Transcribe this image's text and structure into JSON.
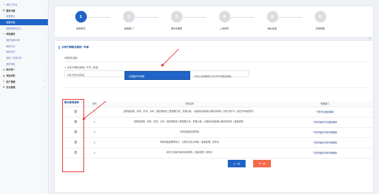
{
  "sidebar": {
    "home": "我的工作台",
    "groups": [
      {
        "label": "服务申报",
        "icon": "grid-icon",
        "items": [
          "我要登记",
          "我要申报",
          "我要审核任务工"
        ]
      },
      {
        "label": "审批服务",
        "icon": "briefcase-icon",
        "items": [
          "我的待审清单",
          "我的已办",
          "我的办件",
          "我的一件事办件",
          "我的消息"
        ]
      },
      {
        "label": "统计统一",
        "icon": "chart-icon",
        "items": []
      },
      {
        "label": "审批材料",
        "icon": "folder-icon",
        "items": []
      },
      {
        "label": "用户管理",
        "icon": "user-icon",
        "items": []
      },
      {
        "label": "安全管理",
        "icon": "shield-icon",
        "items": []
      }
    ]
  },
  "steps": [
    {
      "num": "1",
      "label": "选择事项"
    },
    {
      "num": "2",
      "label": "选择部门"
    },
    {
      "num": "3",
      "label": "填写申报表"
    },
    {
      "num": "4",
      "label": "上传材料"
    },
    {
      "num": "5",
      "label": "确认信息"
    },
    {
      "num": "6",
      "label": "完成申报"
    }
  ],
  "section": {
    "title": "水电气网联合报装一件事",
    "sub_label": "办理情形选择",
    "question": "1. 水电气网联合报装一件事（单选）",
    "option_row_label": "水电气网业务报装",
    "option_selected": "占道路许可审批",
    "option_other": "涉及占用道路施工的水电气网报装审批"
  },
  "table": {
    "title": "联办事项清单",
    "headers": [
      "",
      "序号",
      "事项名称",
      "受理部门"
    ],
    "rows": [
      {
        "no": "1",
        "name": "因修建铁路、机场、供电、水利、通信等建设工程需要占用、挖掘公路、公路用地或者使公路改线审批（改扩建许可（设区的市级权限））",
        "dept": "宁德市交通运输局"
      },
      {
        "no": "2",
        "name": "因修建铁路、机场、供电、水利、通信等建设工程需要占用、挖掘公路、公路用地或者使公路改线审批（县级权限）",
        "dept": "宁德市福安市交通运输局"
      },
      {
        "no": "3",
        "name": "市政设施建设类审批",
        "dept": "宁德市福安市城市管理局"
      },
      {
        "no": "4",
        "name": "特殊或者超限等特大、迁移古树名木审批（县级权限）新申请",
        "dept": "宁德市福安市城市管理局"
      },
      {
        "no": "5",
        "name": "临时占用城市绿化用地审批（县级权限）新申请",
        "dept": "宁德市福安市城市管理局"
      }
    ]
  },
  "buttons": {
    "prev": "上一步",
    "next": "下一步"
  },
  "close_glyph": "×"
}
